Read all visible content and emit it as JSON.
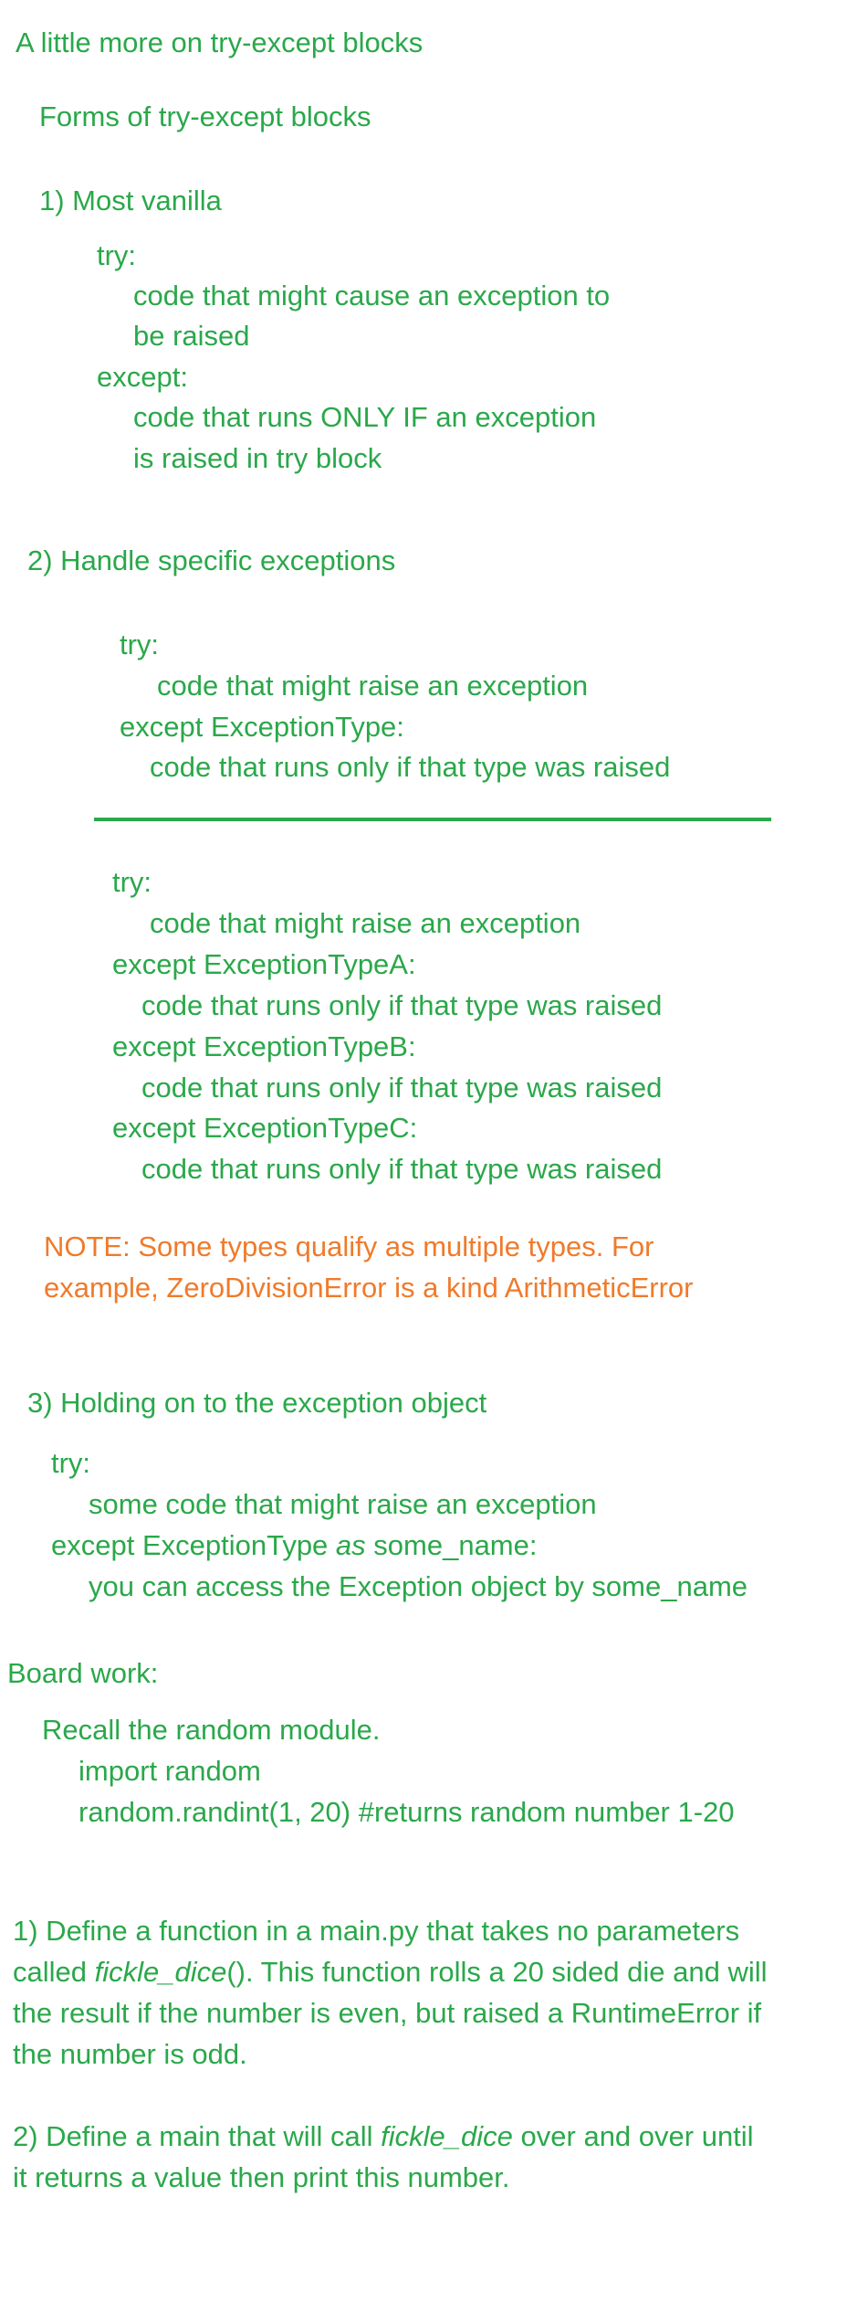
{
  "header": {
    "title": "A little more on try-except blocks",
    "subtitle": "Forms of try-except blocks"
  },
  "section1": {
    "heading": "1) Most vanilla",
    "try_kw": "try:",
    "try_body_1": "code that might cause an exception to",
    "try_body_2": "be raised",
    "except_kw": "except:",
    "except_body_1": "code that runs ONLY IF an exception",
    "except_body_2": "is raised in try block"
  },
  "section2": {
    "heading": "2) Handle specific exceptions",
    "block_a": {
      "try_kw": "try:",
      "try_body": "code that might raise an exception",
      "except_line": "except ExceptionType:",
      "except_body": "code that runs only if that type was raised"
    },
    "block_b": {
      "try_kw": "try:",
      "try_body": "code that might raise an exception",
      "except_a": "except ExceptionTypeA:",
      "except_a_body": "code that runs only if that type was raised",
      "except_b": "except ExceptionTypeB:",
      "except_b_body": "code that runs only if that type was raised",
      "except_c": "except ExceptionTypeC:",
      "except_c_body": "code that runs only if that type was raised"
    },
    "note_1": "NOTE: Some types qualify as multiple types. For",
    "note_2": "example,  ZeroDivisionError is a kind ArithmeticError"
  },
  "section3": {
    "heading": "3) Holding on to the exception object",
    "try_kw": "try:",
    "try_body": "some code that might raise an exception",
    "except_pre": "except ExceptionType ",
    "except_as": "as",
    "except_post": " some_name:",
    "except_body": "you can access the Exception object by some_name"
  },
  "board": {
    "heading": "Board work:",
    "recall": "Recall the random module.",
    "import_line": "import random",
    "randint_line": "random.randint(1, 20) #returns random number 1-20",
    "task1_line1": "1) Define a function in a main.py that takes no parameters",
    "task1_line2_pre": "called ",
    "task1_line2_fn": "fickle_dice",
    "task1_line2_post": "().  This function rolls a 20 sided die and will",
    "task1_line3": "the result if the number is even, but raised a RuntimeError if",
    "task1_line4": "the number is odd.",
    "task2_line1_pre": "2) Define a main that will call ",
    "task2_line1_fn": "fickle_dice",
    "task2_line1_post": " over and over until",
    "task2_line2": "it returns a value then print this number."
  }
}
